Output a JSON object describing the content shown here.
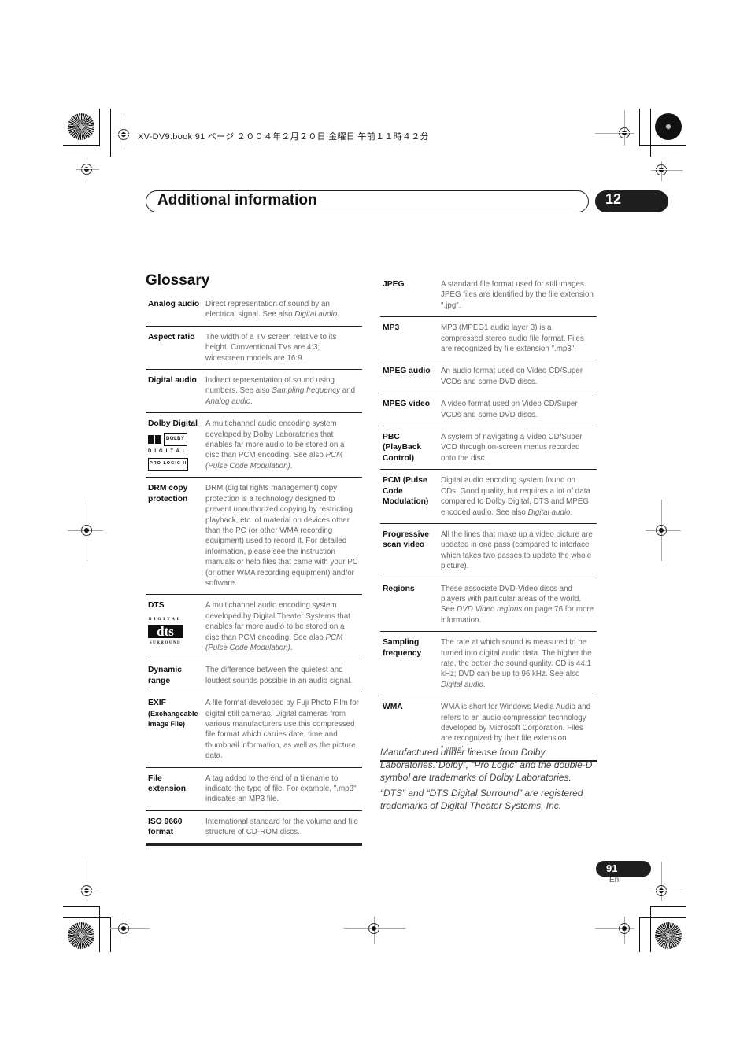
{
  "job_header": "XV-DV9.book  91 ページ  ２００４年２月２０日  金曜日  午前１１時４２分",
  "chapter": {
    "title": "Additional information",
    "number": "12"
  },
  "section_title": "Glossary",
  "glossary_left": [
    {
      "term": "Analog audio",
      "definition": "Direct representation of sound by an electrical signal. See also ",
      "see_also": "Digital audio",
      "tail": "."
    },
    {
      "term": "Aspect ratio",
      "definition": "The width of a TV screen relative to its height. Conventional TVs are 4:3; widescreen models are 16:9."
    },
    {
      "term": "Digital audio",
      "definition": "Indirect representation of sound using numbers. See also ",
      "see_also": "Sampling frequency",
      "mid": " and ",
      "see_also_2": "Analog audio",
      "tail": "."
    },
    {
      "term": "Dolby Digital",
      "definition": "A multichannel audio encoding system developed by Dolby Laboratories that enables far more audio to be stored on a disc than PCM encoding. See also ",
      "see_also": "PCM (Pulse Code Modulation)",
      "tail": ".",
      "logo": {
        "box": "DOLBY",
        "digital": "DIGITAL",
        "pl": "PRO LOGIC II"
      }
    },
    {
      "term": "DRM copy protection",
      "definition": "DRM (digital rights management) copy protection is a technology designed to prevent unauthorized copying by restricting playback, etc. of material on devices other than the PC (or other WMA recording equipment) used to record it. For detailed information, please see the instruction manuals or help files that came with your PC (or other WMA recording equipment) and/or software."
    },
    {
      "term": "DTS",
      "definition": "A multichannel audio encoding system developed by Digital Theater Systems that enables far more audio to be stored on a disc than PCM encoding. See also ",
      "see_also": "PCM (Pulse Code Modulation)",
      "tail": ".",
      "logo": {
        "digital": "DIGITAL",
        "mark": "dts",
        "surround": "SURROUND"
      }
    },
    {
      "term": "Dynamic range",
      "definition": "The difference between the quietest and loudest sounds possible in an audio signal."
    },
    {
      "term": "EXIF",
      "term_sub": "(Exchangeable Image File)",
      "definition": "A file format developed by Fuji Photo Film for digital still cameras. Digital cameras from various manufacturers use this compressed file format which carries date, time and thumbnail information, as well as the picture data."
    },
    {
      "term": "File extension",
      "definition": "A tag added to the end of a filename to indicate the type of file. For example, \".mp3\" indicates an MP3 file."
    },
    {
      "term": "ISO 9660 format",
      "definition": "International standard for the volume and file structure of CD-ROM discs."
    }
  ],
  "glossary_right": [
    {
      "term": "JPEG",
      "definition": "A standard file format used for still images. JPEG files are identified by the file extension \".jpg\"."
    },
    {
      "term": "MP3",
      "definition": "MP3 (MPEG1 audio layer 3) is a compressed stereo audio file format. Files are recognized by file extension \".mp3\"."
    },
    {
      "term": "MPEG audio",
      "definition": "An audio format used on Video CD/Super VCDs and some DVD discs."
    },
    {
      "term": "MPEG video",
      "definition": "A video format used on Video CD/Super VCDs and some DVD discs."
    },
    {
      "term": "PBC (PlayBack Control)",
      "definition": "A system of navigating a Video CD/Super VCD through on-screen menus recorded onto the disc."
    },
    {
      "term": "PCM (Pulse Code Modulation)",
      "definition": "Digital audio encoding system found on CDs. Good quality, but requires a lot of data compared to Dolby Digital, DTS and MPEG encoded audio. See also ",
      "see_also": "Digital audio",
      "tail": "."
    },
    {
      "term": "Progressive scan video",
      "definition": "All the lines that make up a video picture are updated in one pass (compared to interlace which takes two passes to update the whole picture)."
    },
    {
      "term": "Regions",
      "definition": "These associate DVD-Video discs and players with particular areas of the world. See ",
      "see_also": "DVD Video regions",
      "tail": " on page 76 for more information."
    },
    {
      "term": "Sampling frequency",
      "definition": "The rate at which sound is measured to be turned into digital audio data. The higher the rate, the better the sound quality. CD is 44.1 kHz; DVD can be up to 96 kHz. See also ",
      "see_also": "Digital audio",
      "tail": "."
    },
    {
      "term": "WMA",
      "definition": "WMA is short for Windows Media Audio and refers to an audio compression technology developed by Microsoft Corporation. Files are recognized by their file extension \".wma\"."
    }
  ],
  "trademarks": [
    "Manufactured under license from Dolby Laboratories.“Dolby”, “Pro Logic” and the double-D symbol are trademarks of Dolby Laboratories.",
    "“DTS” and “DTS Digital Surround” are registered trademarks of Digital Theater Systems, Inc."
  ],
  "footer": {
    "page_number": "91",
    "language": "En"
  }
}
